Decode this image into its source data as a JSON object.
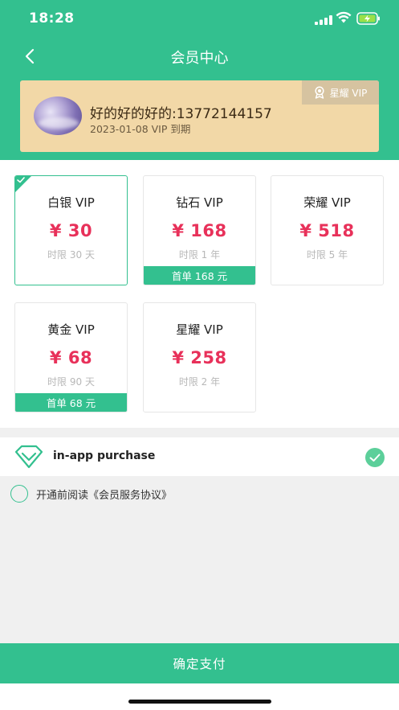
{
  "status_bar": {
    "time": "18:28"
  },
  "nav": {
    "title": "会员中心"
  },
  "member": {
    "name": "好的好的好的:13772144157",
    "expiry": "2023-01-08 VIP 到期",
    "level_badge": "星耀 VIP"
  },
  "plans": [
    {
      "name": "白银 VIP",
      "price": "¥ 30",
      "duration": "时限 30 天",
      "promo": "",
      "selected": true
    },
    {
      "name": "钻石 VIP",
      "price": "¥ 168",
      "duration": "时限 1 年",
      "promo": "首单 168 元",
      "selected": false
    },
    {
      "name": "荣耀 VIP",
      "price": "¥ 518",
      "duration": "时限 5 年",
      "promo": "",
      "selected": false
    },
    {
      "name": "黄金 VIP",
      "price": "¥ 68",
      "duration": "时限 90 天",
      "promo": "首单 68 元",
      "selected": false
    },
    {
      "name": "星耀 VIP",
      "price": "¥ 258",
      "duration": "时限 2 年",
      "promo": "",
      "selected": false
    }
  ],
  "payment": {
    "method_label": "in-app purchase",
    "icon": "diamond-icon",
    "selected": true
  },
  "agreement": {
    "prefix": "开通前阅读",
    "link": "《会员服务协议》",
    "checked": false
  },
  "confirm": {
    "label": "确定支付"
  },
  "colors": {
    "primary": "#33c08f",
    "price": "#e8315a",
    "member_card": "#f2d8a7",
    "level_badge": "#d6c3a0"
  }
}
